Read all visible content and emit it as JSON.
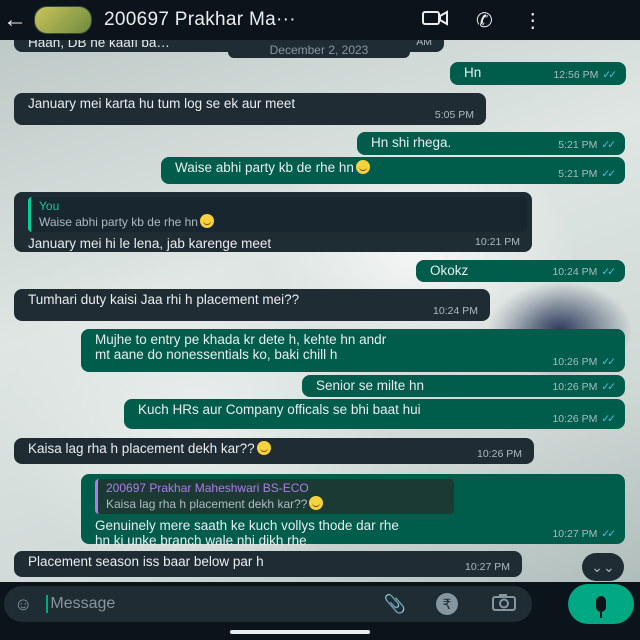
{
  "header": {
    "back_icon": "arrow-left-icon",
    "contact_name": "200697 Prakhar Ma···",
    "video_icon": "video-call-icon",
    "call_icon": "phone-icon",
    "menu_icon": "more-vertical-icon"
  },
  "partial_top": {
    "text": "Haan, DB ne kaafi ba…",
    "time": "AM"
  },
  "date_chip": "December 2, 2023",
  "messages": [
    {
      "dir": "out",
      "text": "Hn",
      "time": "12:56 PM"
    },
    {
      "dir": "in",
      "text": "January mei karta hu tum log se ek aur meet",
      "time": "5:05 PM"
    },
    {
      "dir": "out",
      "text": "Hn shi rhega.",
      "time": "5:21 PM"
    },
    {
      "dir": "out",
      "text": "Waise abhi party kb de rhe hn",
      "time": "5:21 PM"
    },
    {
      "dir": "in",
      "quote_name": "You",
      "quote_text": "Waise abhi party kb de rhe hn",
      "text": "January mei hi le lena, jab karenge meet",
      "time": "10:21 PM"
    },
    {
      "dir": "out",
      "text": "Okokz",
      "time": "10:24 PM"
    },
    {
      "dir": "in",
      "text": "Tumhari duty kaisi Jaa rhi h placement mei??",
      "time": "10:24 PM"
    },
    {
      "dir": "out",
      "line1": "Mujhe to entry pe khada kr dete h, kehte hn andr",
      "line2": "mt aane do nonessentials ko, baki chill h",
      "time": "10:26 PM"
    },
    {
      "dir": "out",
      "text": "Senior se milte hn",
      "time": "10:26 PM"
    },
    {
      "dir": "out",
      "text": "Kuch HRs aur Company officals se bhi baat hui",
      "time": "10:26 PM"
    },
    {
      "dir": "in",
      "text": "Kaisa lag rha h placement dekh kar??",
      "time": "10:26 PM"
    },
    {
      "dir": "out",
      "quote_name": "200697 Prakhar Maheshwari BS-ECO",
      "quote_text": "Kaisa lag rha h placement dekh kar??",
      "line1": "Genuinely mere saath ke kuch vollys thode dar rhe",
      "line2": "hn ki unke branch wale nhi dikh rhe",
      "time": "10:27 PM"
    },
    {
      "dir": "in",
      "text": "Placement season iss baar below par h",
      "time": "10:27 PM"
    }
  ],
  "composer": {
    "emoji_icon": "emoji-icon",
    "placeholder": "Message",
    "attach_icon": "paperclip-icon",
    "payment_icon": "rupee-icon",
    "camera_icon": "camera-icon",
    "mic_icon": "microphone-icon"
  },
  "scroll_icon": "double-chevron-down-icon",
  "colors": {
    "incoming": "#1f2c34",
    "outgoing": "#005c4b",
    "accent": "#00a884",
    "read_tick": "#53bdeb"
  }
}
